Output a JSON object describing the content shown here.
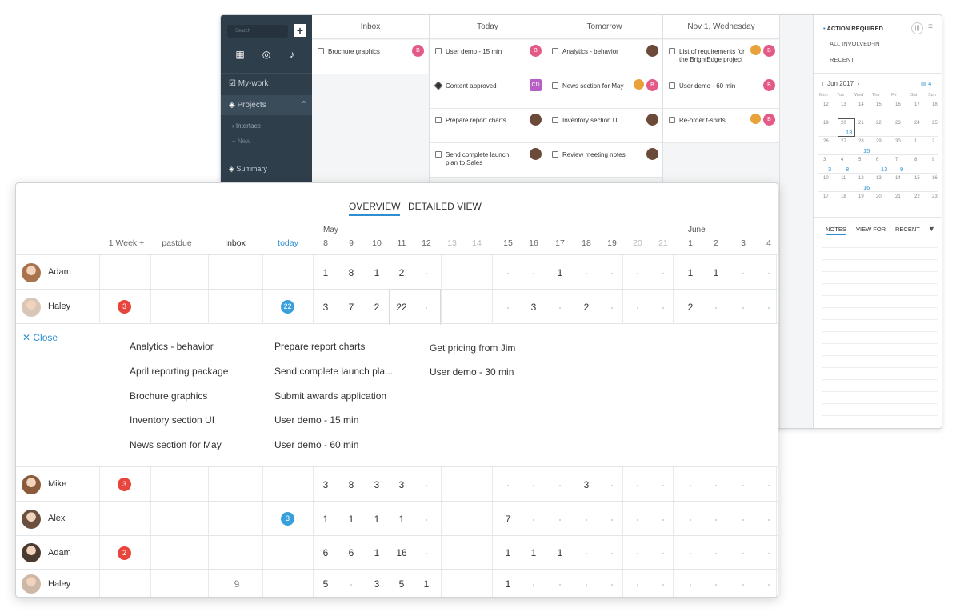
{
  "back": {
    "sidebar": {
      "search_placeholder": "Search",
      "plus": "+",
      "items": [
        {
          "label": "My-work"
        },
        {
          "label": "Projects"
        },
        {
          "label": "Interface"
        },
        {
          "label": "New"
        },
        {
          "label": "Summary"
        }
      ]
    },
    "columns": [
      {
        "title": "Inbox",
        "cards": [
          {
            "text": "Brochure graphics",
            "avatar": "B"
          }
        ]
      },
      {
        "title": "Today",
        "cards": [
          {
            "text": "User demo - 15 min",
            "avatar": "B"
          },
          {
            "text": "Content approved",
            "avatar": "CD"
          },
          {
            "text": "Prepare report charts",
            "avatar": ""
          },
          {
            "text": "Send complete launch plan to Sales",
            "avatar": ""
          }
        ]
      },
      {
        "title": "Tomorrow",
        "cards": [
          {
            "text": "Analytics - behavior",
            "avatar": ""
          },
          {
            "text": "News section for May",
            "avatar": "B"
          },
          {
            "text": "Inventory section UI",
            "avatar": ""
          },
          {
            "text": "Review meeting notes",
            "avatar": ""
          }
        ]
      },
      {
        "title": "Nov 1, Wednesday",
        "cards": [
          {
            "text": "List of requirements for the BrightEdge project",
            "avatar": "B"
          },
          {
            "text": "User demo - 60 min",
            "avatar": "B"
          },
          {
            "text": "Re-order t-shirts",
            "avatar": "B"
          }
        ]
      }
    ],
    "right": {
      "links": [
        "ACTION REQUIRED",
        "ALL INVOLVED-IN",
        "RECENT"
      ],
      "cal_month": "Jun 2017",
      "cal_badge": "4",
      "weekdays": [
        "Mon",
        "Tue",
        "Wed",
        "Thu",
        "Fri",
        "Sat",
        "Sun"
      ],
      "weeks": [
        [
          "12",
          "13",
          "14",
          "15",
          "16",
          "17",
          "18"
        ],
        [
          "19",
          "20",
          "21",
          "22",
          "23",
          "24",
          "25"
        ],
        [
          "26",
          "27",
          "28",
          "29",
          "30",
          "1",
          "2"
        ],
        [
          "3",
          "4",
          "5",
          "6",
          "7",
          "8",
          "9"
        ],
        [
          "10",
          "11",
          "12",
          "13",
          "14",
          "15",
          "16"
        ],
        [
          "17",
          "18",
          "19",
          "20",
          "21",
          "22",
          "23"
        ]
      ],
      "blue": [
        [
          "",
          "",
          "",
          "",
          "",
          "",
          ""
        ],
        [
          "",
          "13",
          "",
          "",
          "",
          "",
          ""
        ],
        [
          "",
          "",
          "15",
          "",
          "",
          "",
          ""
        ],
        [
          "3",
          "8",
          "",
          "13",
          "9",
          "",
          ""
        ],
        [
          "",
          "",
          "16",
          "",
          "",
          "",
          ""
        ],
        [
          "",
          "",
          "",
          "",
          "",
          "",
          ""
        ]
      ],
      "notes_tabs": [
        "NOTES",
        "VIEW FOR",
        "RECENT"
      ]
    }
  },
  "front": {
    "tabs": [
      "OVERVIEW",
      "DETAILED VIEW"
    ],
    "headers": [
      "1 Week +",
      "pastdue",
      "Inbox",
      "today"
    ],
    "months": [
      "May",
      "June"
    ],
    "days": [
      "8",
      "9",
      "10",
      "11",
      "12",
      "13",
      "14",
      "15",
      "16",
      "17",
      "18",
      "19",
      "20",
      "21",
      "1",
      "2",
      "3",
      "4"
    ],
    "close": "Close",
    "rows": [
      {
        "name": "Adam",
        "pastdue": "",
        "inbox": "",
        "today": "",
        "vals": [
          "1",
          "8",
          "1",
          "2",
          "",
          "",
          "",
          "",
          "",
          "1",
          "",
          "",
          "",
          "",
          "1",
          "1",
          "",
          ""
        ]
      },
      {
        "name": "Haley",
        "pastdue": "3",
        "inbox": "",
        "today": "22",
        "vals": [
          "3",
          "7",
          "2",
          "22",
          "",
          "",
          "",
          "",
          "3",
          "",
          "2",
          "",
          "",
          "",
          "2",
          "",
          "",
          ""
        ]
      },
      {
        "name": "Mike",
        "pastdue": "3",
        "inbox": "",
        "today": "",
        "vals": [
          "3",
          "8",
          "3",
          "3",
          "",
          "",
          "",
          "",
          "",
          "",
          "3",
          "",
          "",
          "",
          "",
          "",
          "",
          ""
        ]
      },
      {
        "name": "Alex",
        "pastdue": "",
        "inbox": "",
        "today": "3",
        "vals": [
          "1",
          "1",
          "1",
          "1",
          "",
          "",
          "",
          "7",
          "",
          "",
          "",
          "",
          "",
          "",
          "",
          "",
          "",
          ""
        ]
      },
      {
        "name": "Adam",
        "pastdue": "2",
        "inbox": "",
        "today": "",
        "vals": [
          "6",
          "6",
          "1",
          "16",
          "",
          "",
          "",
          "1",
          "1",
          "1",
          "",
          "",
          "",
          "",
          "",
          "",
          "",
          ""
        ]
      },
      {
        "name": "Haley",
        "pastdue": "",
        "inbox": "9",
        "today": "",
        "vals": [
          "5",
          "",
          "3",
          "5",
          "1",
          "",
          "",
          "1",
          "",
          "",
          "",
          "",
          "",
          "",
          "",
          "",
          "",
          ""
        ]
      }
    ],
    "tasks": [
      [
        "Analytics - behavior",
        "April reporting package",
        "Brochure graphics",
        "Inventory section UI",
        "News section for May"
      ],
      [
        "Prepare report charts",
        "Send complete launch pla...",
        "Submit awards application",
        "User demo - 15 min",
        "User demo - 60 min"
      ],
      [
        "Get pricing from Jim",
        "User demo - 30 min"
      ]
    ]
  }
}
